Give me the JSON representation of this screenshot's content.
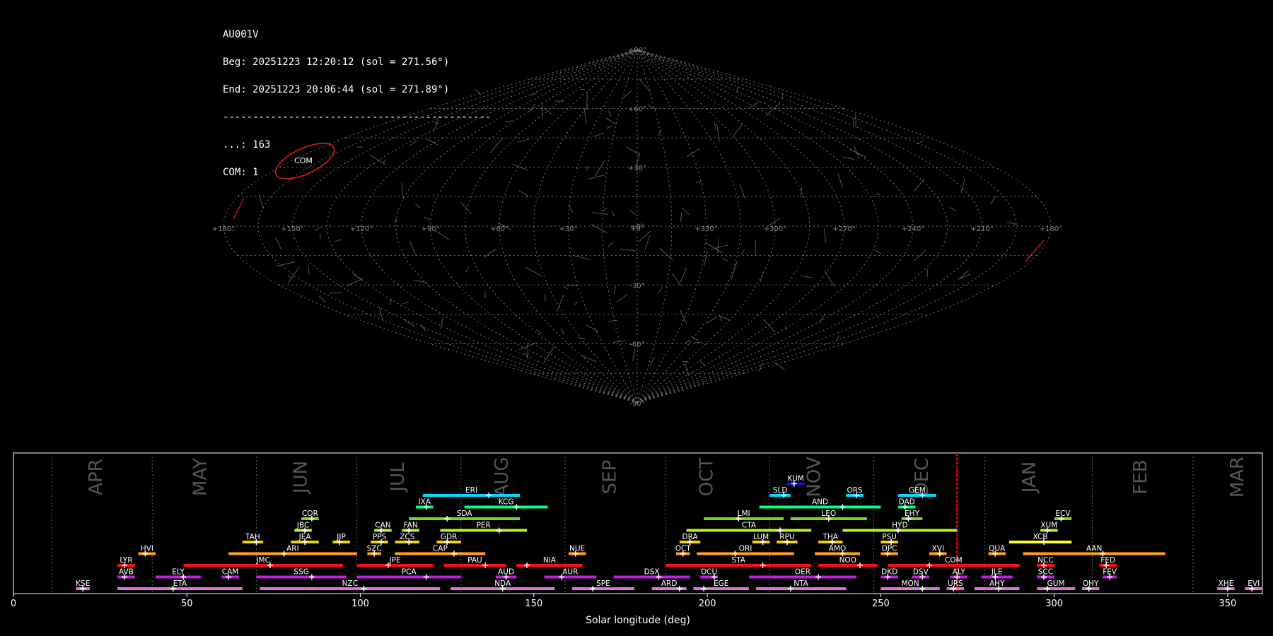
{
  "header": {
    "station": "AU001V",
    "begin": "Beg: 20251223 12:20:12 (sol = 271.56°)",
    "end": "End: 20251223 20:06:44 (sol = 271.89°)",
    "separator": "---------------------------------------------",
    "count_sporadic": "...: 163",
    "count_com": "COM: 1"
  },
  "sky_map": {
    "projection": "sinusoidal",
    "lat_labels": [
      "+90°",
      "+60°",
      "+30°",
      "+0°",
      "-30°",
      "-60°",
      "-90°"
    ],
    "lon_labels": [
      "+180°",
      "+150°",
      "+120°",
      "+90°",
      "+60°",
      "+30°",
      "+0°",
      "+330°",
      "+300°",
      "+270°",
      "+240°",
      "+210°",
      "+180°"
    ],
    "shower_label": "COM",
    "colors": {
      "grid": "#777777",
      "radiant": "#e82020",
      "trail": "#9a9a9a"
    }
  },
  "chart_data": {
    "type": "gantt",
    "xlabel": "Solar longitude (deg)",
    "xlim": [
      0,
      360
    ],
    "xticks": [
      0,
      50,
      100,
      150,
      200,
      250,
      300,
      350
    ],
    "current_sol": 272,
    "months": [
      {
        "name": "APR",
        "sep": 11,
        "label": 24
      },
      {
        "name": "MAY",
        "sep": 40,
        "label": 54
      },
      {
        "name": "JUN",
        "sep": 70,
        "label": 83
      },
      {
        "name": "JUL",
        "sep": 99,
        "label": 111
      },
      {
        "name": "AUG",
        "sep": 129,
        "label": 141
      },
      {
        "name": "SEP",
        "sep": 159,
        "label": 172
      },
      {
        "name": "OCT",
        "sep": 188,
        "label": 200
      },
      {
        "name": "NOV",
        "sep": 218,
        "label": 231
      },
      {
        "name": "DEC",
        "sep": 248,
        "label": 262
      },
      {
        "name": "JAN",
        "sep": 280,
        "label": 293
      },
      {
        "name": "FEB",
        "sep": 311,
        "label": 325
      },
      {
        "name": "MAR",
        "sep": 340,
        "label": 353
      }
    ],
    "showers": [
      {
        "code": "KUM",
        "row": 10,
        "start": 223,
        "end": 228,
        "peak": 225,
        "color": "#1010d0"
      },
      {
        "code": "ERI",
        "row": 9,
        "start": 118,
        "end": 146,
        "peak": 137,
        "color": "#00d8ff"
      },
      {
        "code": "SLD",
        "row": 9,
        "start": 218,
        "end": 224,
        "peak": 222,
        "color": "#00d8ff"
      },
      {
        "code": "ORS",
        "row": 9,
        "start": 240,
        "end": 245,
        "peak": 243,
        "color": "#00d8ff"
      },
      {
        "code": "GEM",
        "row": 9,
        "start": 255,
        "end": 266,
        "peak": 262,
        "color": "#00d8ff"
      },
      {
        "code": "IXA",
        "row": 8,
        "start": 116,
        "end": 121,
        "peak": 119,
        "color": "#00ff88"
      },
      {
        "code": "KCG",
        "row": 8,
        "start": 130,
        "end": 154,
        "peak": 145,
        "color": "#00ff88"
      },
      {
        "code": "AND",
        "row": 8,
        "start": 215,
        "end": 250,
        "peak": 239,
        "color": "#00ff88"
      },
      {
        "code": "DAD",
        "row": 8,
        "start": 255,
        "end": 260,
        "peak": 257,
        "color": "#00ff88"
      },
      {
        "code": "COR",
        "row": 7,
        "start": 83,
        "end": 88,
        "peak": 86,
        "color": "#66dd22"
      },
      {
        "code": "SDA",
        "row": 7,
        "start": 114,
        "end": 146,
        "peak": 125,
        "color": "#66dd22"
      },
      {
        "code": "LMI",
        "row": 7,
        "start": 199,
        "end": 222,
        "peak": 209,
        "color": "#66dd22"
      },
      {
        "code": "LEO",
        "row": 7,
        "start": 224,
        "end": 246,
        "peak": 235,
        "color": "#66dd22"
      },
      {
        "code": "EHY",
        "row": 7,
        "start": 256,
        "end": 262,
        "peak": 258,
        "color": "#66dd22"
      },
      {
        "code": "ECV",
        "row": 7,
        "start": 300,
        "end": 305,
        "peak": 302,
        "color": "#66dd22"
      },
      {
        "code": "JBC",
        "row": 6,
        "start": 81,
        "end": 86,
        "peak": 84,
        "color": "#b8f020"
      },
      {
        "code": "CAN",
        "row": 6,
        "start": 104,
        "end": 109,
        "peak": 106,
        "color": "#b8f020"
      },
      {
        "code": "FAN",
        "row": 6,
        "start": 112,
        "end": 117,
        "peak": 114,
        "color": "#b8f020"
      },
      {
        "code": "PER",
        "row": 6,
        "start": 123,
        "end": 148,
        "peak": 140,
        "color": "#b8f020"
      },
      {
        "code": "CTA",
        "row": 6,
        "start": 194,
        "end": 230,
        "peak": 221,
        "color": "#b8f020"
      },
      {
        "code": "HYD",
        "row": 6,
        "start": 239,
        "end": 272,
        "peak": 255,
        "color": "#b8f020"
      },
      {
        "code": "XUM",
        "row": 6,
        "start": 296,
        "end": 301,
        "peak": 298,
        "color": "#b8f020"
      },
      {
        "code": "TAH",
        "row": 5,
        "start": 66,
        "end": 72,
        "peak": 70,
        "color": "#f0d010"
      },
      {
        "code": "JEA",
        "row": 5,
        "start": 80,
        "end": 88,
        "peak": 84,
        "color": "#f0d010"
      },
      {
        "code": "JIP",
        "row": 5,
        "start": 92,
        "end": 97,
        "peak": 94,
        "color": "#f0d010"
      },
      {
        "code": "PPS",
        "row": 5,
        "start": 103,
        "end": 108,
        "peak": 106,
        "color": "#f0d010"
      },
      {
        "code": "ZCS",
        "row": 5,
        "start": 110,
        "end": 117,
        "peak": 114,
        "color": "#f0d010"
      },
      {
        "code": "GDR",
        "row": 5,
        "start": 122,
        "end": 129,
        "peak": 125,
        "color": "#f0d010"
      },
      {
        "code": "DRA",
        "row": 5,
        "start": 192,
        "end": 198,
        "peak": 195,
        "color": "#f0d010"
      },
      {
        "code": "LUM",
        "row": 5,
        "start": 213,
        "end": 218,
        "peak": 216,
        "color": "#f0d010"
      },
      {
        "code": "RPU",
        "row": 5,
        "start": 220,
        "end": 226,
        "peak": 223,
        "color": "#f0d010"
      },
      {
        "code": "THA",
        "row": 5,
        "start": 232,
        "end": 239,
        "peak": 236,
        "color": "#f0d010"
      },
      {
        "code": "PSU",
        "row": 5,
        "start": 250,
        "end": 255,
        "peak": 253,
        "color": "#f0d010"
      },
      {
        "code": "XCB",
        "row": 5,
        "start": 287,
        "end": 305,
        "peak": 297,
        "color": "#ffff20"
      },
      {
        "code": "HVI",
        "row": 4,
        "start": 36,
        "end": 41,
        "peak": 38,
        "color": "#ffa020"
      },
      {
        "code": "ARI",
        "row": 4,
        "start": 62,
        "end": 99,
        "peak": 78,
        "color": "#ffa020"
      },
      {
        "code": "SZC",
        "row": 4,
        "start": 102,
        "end": 106,
        "peak": 104,
        "color": "#ffa020"
      },
      {
        "code": "CAP",
        "row": 4,
        "start": 110,
        "end": 136,
        "peak": 127,
        "color": "#ffa020"
      },
      {
        "code": "NUE",
        "row": 4,
        "start": 160,
        "end": 165,
        "peak": 162,
        "color": "#ffa020"
      },
      {
        "code": "OCT",
        "row": 4,
        "start": 191,
        "end": 195,
        "peak": 193,
        "color": "#ffa020"
      },
      {
        "code": "ORI",
        "row": 4,
        "start": 197,
        "end": 225,
        "peak": 208,
        "color": "#ffa020"
      },
      {
        "code": "AMO",
        "row": 4,
        "start": 231,
        "end": 244,
        "peak": 239,
        "color": "#ffa020"
      },
      {
        "code": "DPC",
        "row": 4,
        "start": 250,
        "end": 255,
        "peak": 252,
        "color": "#ffa020"
      },
      {
        "code": "XVI",
        "row": 4,
        "start": 264,
        "end": 269,
        "peak": 267,
        "color": "#ffa020"
      },
      {
        "code": "QUA",
        "row": 4,
        "start": 281,
        "end": 286,
        "peak": 283,
        "color": "#ffa020"
      },
      {
        "code": "AAN",
        "row": 4,
        "start": 291,
        "end": 332,
        "peak": 314,
        "color": "#ffa020"
      },
      {
        "code": "LYR",
        "row": 3,
        "start": 30,
        "end": 35,
        "peak": 32,
        "color": "#ff1010"
      },
      {
        "code": "JMC",
        "row": 3,
        "start": 49,
        "end": 95,
        "peak": 74,
        "color": "#ff1010"
      },
      {
        "code": "JPE",
        "row": 3,
        "start": 99,
        "end": 121,
        "peak": 108,
        "color": "#ff1010"
      },
      {
        "code": "PAU",
        "row": 3,
        "start": 124,
        "end": 142,
        "peak": 136,
        "color": "#ff1010"
      },
      {
        "code": "NIA",
        "row": 3,
        "start": 145,
        "end": 164,
        "peak": 148,
        "color": "#ff1010"
      },
      {
        "code": "STA",
        "row": 3,
        "start": 188,
        "end": 230,
        "peak": 216,
        "color": "#ff1010"
      },
      {
        "code": "NOO",
        "row": 3,
        "start": 232,
        "end": 249,
        "peak": 244,
        "color": "#ff1010"
      },
      {
        "code": "COM",
        "row": 3,
        "start": 252,
        "end": 290,
        "peak": 264,
        "color": "#ff1010"
      },
      {
        "code": "NCC",
        "row": 3,
        "start": 295,
        "end": 300,
        "peak": 297,
        "color": "#ff1010"
      },
      {
        "code": "FED",
        "row": 3,
        "start": 313,
        "end": 318,
        "peak": 315,
        "color": "#ff1010"
      },
      {
        "code": "AVB",
        "row": 2,
        "start": 30,
        "end": 35,
        "peak": 32,
        "color": "#c020e0"
      },
      {
        "code": "ELY",
        "row": 2,
        "start": 41,
        "end": 54,
        "peak": 49,
        "color": "#c020e0"
      },
      {
        "code": "CAM",
        "row": 2,
        "start": 60,
        "end": 65,
        "peak": 62,
        "color": "#c020e0"
      },
      {
        "code": "SSG",
        "row": 2,
        "start": 70,
        "end": 96,
        "peak": 86,
        "color": "#c020e0"
      },
      {
        "code": "PCA",
        "row": 2,
        "start": 99,
        "end": 129,
        "peak": 119,
        "color": "#c020e0"
      },
      {
        "code": "AUD",
        "row": 2,
        "start": 139,
        "end": 145,
        "peak": 142,
        "color": "#c020e0"
      },
      {
        "code": "AUR",
        "row": 2,
        "start": 153,
        "end": 168,
        "peak": 158,
        "color": "#c020e0"
      },
      {
        "code": "DSX",
        "row": 2,
        "start": 173,
        "end": 195,
        "peak": 186,
        "color": "#c020e0"
      },
      {
        "code": "OCU",
        "row": 2,
        "start": 198,
        "end": 203,
        "peak": 202,
        "color": "#c020e0"
      },
      {
        "code": "OER",
        "row": 2,
        "start": 212,
        "end": 243,
        "peak": 232,
        "color": "#c020e0"
      },
      {
        "code": "DKD",
        "row": 2,
        "start": 250,
        "end": 255,
        "peak": 252,
        "color": "#c020e0"
      },
      {
        "code": "DSV",
        "row": 2,
        "start": 259,
        "end": 264,
        "peak": 262,
        "color": "#c020e0"
      },
      {
        "code": "ALY",
        "row": 2,
        "start": 270,
        "end": 275,
        "peak": 272,
        "color": "#c020e0"
      },
      {
        "code": "JLE",
        "row": 2,
        "start": 279,
        "end": 288,
        "peak": 283,
        "color": "#c020e0"
      },
      {
        "code": "SCC",
        "row": 2,
        "start": 295,
        "end": 300,
        "peak": 297,
        "color": "#c020e0"
      },
      {
        "code": "FEV",
        "row": 2,
        "start": 314,
        "end": 318,
        "peak": 316,
        "color": "#c020e0"
      },
      {
        "code": "KSE",
        "row": 1,
        "start": 18,
        "end": 22,
        "peak": 20,
        "color": "#e070e0"
      },
      {
        "code": "ETA",
        "row": 1,
        "start": 30,
        "end": 66,
        "peak": 46,
        "color": "#e070e0"
      },
      {
        "code": "NZC",
        "row": 1,
        "start": 71,
        "end": 123,
        "peak": 101,
        "color": "#e070e0"
      },
      {
        "code": "NDA",
        "row": 1,
        "start": 126,
        "end": 156,
        "peak": 141,
        "color": "#e070e0"
      },
      {
        "code": "SPE",
        "row": 1,
        "start": 161,
        "end": 179,
        "peak": 167,
        "color": "#e070e0"
      },
      {
        "code": "ARD",
        "row": 1,
        "start": 184,
        "end": 194,
        "peak": 192,
        "color": "#e070e0"
      },
      {
        "code": "EGE",
        "row": 1,
        "start": 196,
        "end": 212,
        "peak": 199,
        "color": "#e070e0"
      },
      {
        "code": "NTA",
        "row": 1,
        "start": 214,
        "end": 240,
        "peak": 224,
        "color": "#e070e0"
      },
      {
        "code": "MON",
        "row": 1,
        "start": 250,
        "end": 267,
        "peak": 262,
        "color": "#e070e0"
      },
      {
        "code": "URS",
        "row": 1,
        "start": 269,
        "end": 274,
        "peak": 271,
        "color": "#e070e0"
      },
      {
        "code": "AHY",
        "row": 1,
        "start": 277,
        "end": 290,
        "peak": 284,
        "color": "#e070e0"
      },
      {
        "code": "GUM",
        "row": 1,
        "start": 295,
        "end": 306,
        "peak": 298,
        "color": "#e070e0"
      },
      {
        "code": "OHY",
        "row": 1,
        "start": 308,
        "end": 313,
        "peak": 310,
        "color": "#e070e0"
      },
      {
        "code": "XHE",
        "row": 1,
        "start": 347,
        "end": 352,
        "peak": 350,
        "color": "#e070e0"
      },
      {
        "code": "EVI",
        "row": 1,
        "start": 355,
        "end": 360,
        "peak": 357,
        "color": "#e070e0"
      }
    ]
  }
}
